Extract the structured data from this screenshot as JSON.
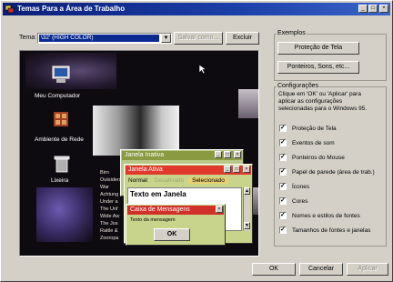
{
  "window": {
    "title": "Temas Para a Área de Trabalho"
  },
  "theme_row": {
    "label": "Tema:",
    "selected": "\\32' (HIGH COLOR)",
    "save_label": "Salvar como...",
    "delete_label": "Excluir"
  },
  "preview": {
    "icons": {
      "computer": "Meu Computador",
      "network": "Ambiente de Rede",
      "trash": "Lixeira"
    },
    "inactive_window": {
      "title": "Janela Inativa"
    },
    "active_window": {
      "title": "Janela Ativa",
      "menu": [
        "Normal",
        "Desativado",
        "Selecionado"
      ],
      "text": "Texto em Janela"
    },
    "message_box": {
      "title": "Caixa de Mensagens",
      "text": "Texto da mensagem",
      "ok": "OK"
    },
    "list_lines": [
      "Birn",
      "Outsiders",
      "War",
      "Achtung",
      "Under a",
      "The Unf",
      "Wide Aw",
      "The Jos",
      "Rattle &",
      "Zooropa"
    ]
  },
  "examples": {
    "label": "Exemplos",
    "screensaver": "Proteção de Tela",
    "pointers": "Ponteiros, Sons, etc..."
  },
  "settings": {
    "label": "Configurações",
    "description": [
      "Clique em 'OK' ou 'Aplicar' para",
      "aplicar as configurações",
      "selecionadas para o Windows 95."
    ],
    "items": [
      "Proteção de Tela",
      "Eventos de som",
      "Ponteiros do Mouse",
      "Papel de parede (área de trab.)",
      "Ícones",
      "Cores",
      "Nomes e estilos de fontes",
      "Tamanhos de fontes e janelas"
    ]
  },
  "footer": {
    "ok": "OK",
    "cancel": "Cancelar",
    "apply": "Aplicar"
  },
  "colors": {
    "titlebar": "#0a1e78",
    "active_title": "#e03a2c",
    "inactive_title": "#8a9a40",
    "msg_title": "#d0322a",
    "face": "#d4d0c8"
  }
}
